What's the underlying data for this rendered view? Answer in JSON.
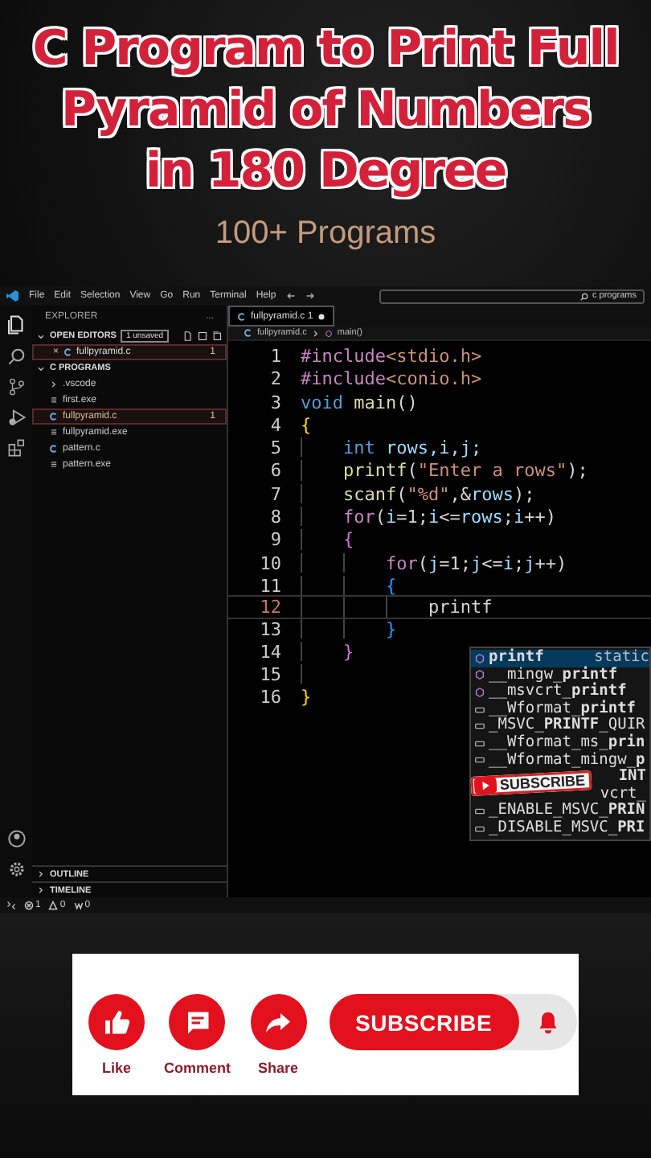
{
  "title": {
    "lines": [
      "C Program to Print Full",
      "Pyramid of Numbers",
      "in 180 Degree"
    ]
  },
  "subtitle": "100+ Programs",
  "editor_window": {
    "menu": [
      "File",
      "Edit",
      "Selection",
      "View",
      "Go",
      "Run",
      "Terminal",
      "Help"
    ],
    "search": {
      "value": "c programs"
    },
    "explorer": {
      "heading": "EXPLORER",
      "more": "...",
      "open_editors": {
        "label": "OPEN EDITORS",
        "badge": "1 unsaved",
        "items": [
          {
            "close": "×",
            "name": "fullpyramid.c",
            "problems": "1",
            "selected": true
          }
        ]
      },
      "folder": {
        "label": "C PROGRAMS",
        "items": [
          {
            "kind": "folder",
            "name": ".vscode",
            "selected": false
          },
          {
            "kind": "exe",
            "name": "first.exe",
            "selected": false
          },
          {
            "kind": "c",
            "name": "fullpyramid.c",
            "problems": "1",
            "selected": true
          },
          {
            "kind": "exe",
            "name": "fullpyramid.exe",
            "selected": false
          },
          {
            "kind": "c",
            "name": "pattern.c",
            "selected": false
          },
          {
            "kind": "exe",
            "name": "pattern.exe",
            "selected": false
          }
        ]
      },
      "sections": [
        "OUTLINE",
        "TIMELINE"
      ]
    },
    "tabs": [
      {
        "name": "fullpyramid.c",
        "problems": "1",
        "modified": true,
        "selected": true
      }
    ],
    "breadcrumb": [
      "fullpyramid.c",
      "main()"
    ],
    "code": [
      {
        "n": "1",
        "tokens": [
          {
            "kind": "pre",
            "t": "#include"
          },
          {
            "kind": "str",
            "t": "<stdio.h>"
          }
        ]
      },
      {
        "n": "2",
        "tokens": [
          {
            "kind": "pre",
            "t": "#include"
          },
          {
            "kind": "str",
            "t": "<conio.h>"
          }
        ]
      },
      {
        "n": "3",
        "tokens": [
          {
            "kind": "kw",
            "t": "void "
          },
          {
            "kind": "fn",
            "t": "main"
          },
          {
            "kind": "plain",
            "t": "()"
          }
        ]
      },
      {
        "n": "4",
        "tokens": [
          {
            "kind": "brace",
            "t": "{"
          }
        ],
        "children": [
          {
            "n": "5",
            "tokens": [
              {
                "kind": "kw",
                "t": "int "
              },
              {
                "kind": "var",
                "t": "rows,i,j;"
              }
            ]
          },
          {
            "n": "6",
            "tokens": [
              {
                "kind": "fn",
                "t": "printf"
              },
              {
                "kind": "plain",
                "t": "("
              },
              {
                "kind": "str",
                "t": "\"Enter a rows\""
              },
              {
                "kind": "plain",
                "t": ");"
              }
            ]
          },
          {
            "n": "7",
            "tokens": [
              {
                "kind": "fn",
                "t": "scanf"
              },
              {
                "kind": "plain",
                "t": "("
              },
              {
                "kind": "str",
                "t": "\"%d\""
              },
              {
                "kind": "plain",
                "t": ",&"
              },
              {
                "kind": "var",
                "t": "rows"
              },
              {
                "kind": "plain",
                "t": ");"
              }
            ]
          },
          {
            "n": "8",
            "tokens": [
              {
                "kind": "kw2",
                "t": "for"
              },
              {
                "kind": "plain",
                "t": "("
              },
              {
                "kind": "var",
                "t": "i"
              },
              {
                "kind": "plain",
                "t": "=1;"
              },
              {
                "kind": "var",
                "t": "i"
              },
              {
                "kind": "plain",
                "t": "<="
              },
              {
                "kind": "var",
                "t": "rows"
              },
              {
                "kind": "plain",
                "t": ";"
              },
              {
                "kind": "var",
                "t": "i"
              },
              {
                "kind": "plain",
                "t": "++)"
              }
            ]
          },
          {
            "n": "9",
            "tokens": [
              {
                "kind": "brace2",
                "t": "{"
              }
            ],
            "children": [
              {
                "n": "10",
                "tokens": [
                  {
                    "kind": "kw2",
                    "t": "for"
                  },
                  {
                    "kind": "plain",
                    "t": "("
                  },
                  {
                    "kind": "var",
                    "t": "j"
                  },
                  {
                    "kind": "plain",
                    "t": "=1;"
                  },
                  {
                    "kind": "var",
                    "t": "j"
                  },
                  {
                    "kind": "plain",
                    "t": "<="
                  },
                  {
                    "kind": "var",
                    "t": "i"
                  },
                  {
                    "kind": "plain",
                    "t": ";"
                  },
                  {
                    "kind": "var",
                    "t": "j"
                  },
                  {
                    "kind": "plain",
                    "t": "++)"
                  }
                ]
              },
              {
                "n": "11",
                "tokens": [
                  {
                    "kind": "brace3",
                    "t": "{"
                  }
                ],
                "children": [
                  {
                    "n": "12",
                    "current": true,
                    "tokens": [
                      {
                        "kind": "plain",
                        "t": "printf"
                      }
                    ]
                  }
                ]
              },
              {
                "n": "13",
                "tokens": [
                  {
                    "kind": "brace3",
                    "t": "}"
                  }
                ]
              }
            ]
          },
          {
            "n": "14",
            "tokens": [
              {
                "kind": "brace2",
                "t": "}"
              }
            ]
          },
          {
            "n": "15"
          }
        ]
      },
      {
        "n": "16",
        "tokens": [
          {
            "kind": "brace",
            "t": "}"
          }
        ]
      }
    ],
    "suggestions": [
      {
        "kind": "func",
        "label": "**printf**",
        "detail": "static",
        "selected": true
      },
      {
        "kind": "func",
        "label": "__mingw_**printf**",
        "selected": false
      },
      {
        "kind": "func",
        "label": "__msvcrt_**printf**",
        "selected": false
      },
      {
        "kind": "macro",
        "label": "__Wformat_**printf**",
        "selected": false
      },
      {
        "kind": "macro",
        "label": "_MSVC_**PRINTF**_QUIR",
        "selected": false
      },
      {
        "kind": "macro",
        "label": "__Wformat_ms_**prin**",
        "selected": false
      },
      {
        "kind": "macro",
        "label": "__Wformat_mingw_**p**",
        "selected": false
      },
      {
        "kind": "hidden",
        "label": "**INT**",
        "selected": false
      },
      {
        "kind": "hidden",
        "label": "vcrt_",
        "selected": false
      },
      {
        "kind": "macro",
        "label": "_ENABLE_MSVC_**PRIN**",
        "selected": false
      },
      {
        "kind": "macro",
        "label": "_DISABLE_MSVC_**PRI**",
        "selected": false
      }
    ],
    "status": [
      {
        "kind": "error",
        "t": "1"
      },
      {
        "kind": "warning",
        "t": "0"
      },
      {
        "kind": "port",
        "t": "0"
      }
    ]
  },
  "sticker": {
    "label": "SUBSCRIBE"
  },
  "actions": [
    {
      "kind": "like",
      "label": "Like"
    },
    {
      "kind": "comment",
      "label": "Comment"
    },
    {
      "kind": "share",
      "label": "Share"
    }
  ],
  "subscribe": {
    "label": "SUBSCRIBE"
  }
}
